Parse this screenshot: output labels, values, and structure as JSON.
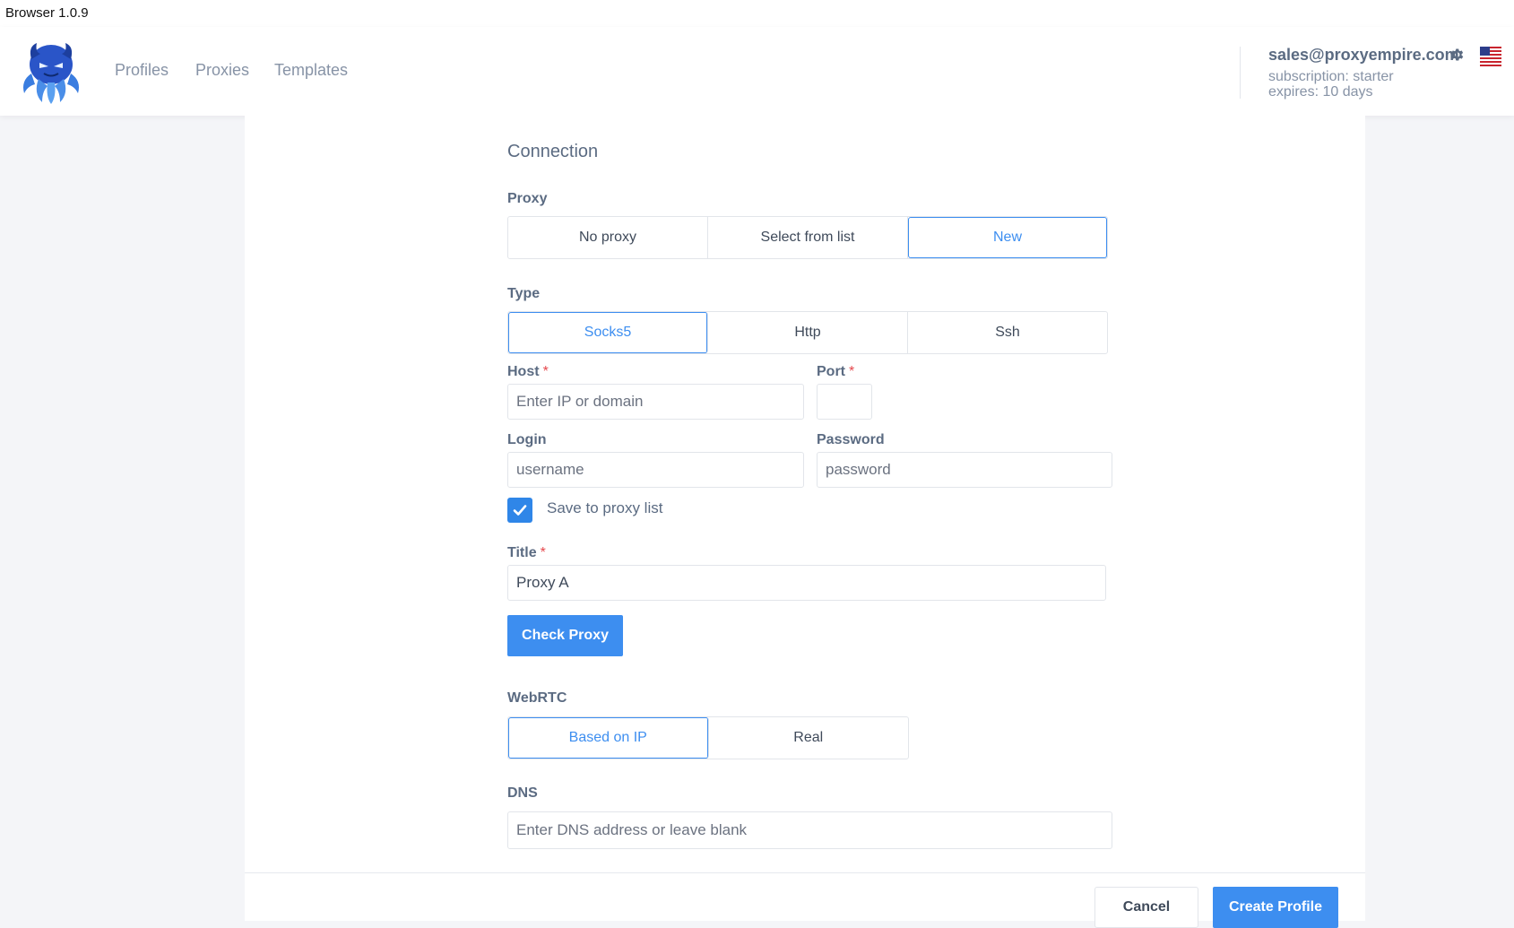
{
  "window": {
    "title": "Browser 1.0.9"
  },
  "nav": {
    "items": [
      "Profiles",
      "Proxies",
      "Templates"
    ]
  },
  "account": {
    "email": "sales@proxyempire.com",
    "subscription": "subscription: starter",
    "expires": "expires: 10 days"
  },
  "connection": {
    "section_title": "Connection",
    "proxy": {
      "label": "Proxy",
      "options": [
        "No proxy",
        "Select from list",
        "New"
      ],
      "selected": "New"
    },
    "type": {
      "label": "Type",
      "options": [
        "Socks5",
        "Http",
        "Ssh"
      ],
      "selected": "Socks5"
    },
    "host": {
      "label": "Host",
      "required_mark": "*",
      "placeholder": "Enter IP or domain",
      "value": ""
    },
    "port": {
      "label": "Port",
      "required_mark": "*",
      "value": ""
    },
    "login": {
      "label": "Login",
      "placeholder": "username",
      "value": ""
    },
    "password": {
      "label": "Password",
      "placeholder": "password",
      "value": ""
    },
    "save_to_list": {
      "label": "Save to proxy list",
      "checked": true
    },
    "title": {
      "label": "Title",
      "required_mark": "*",
      "value": "Proxy A"
    },
    "check_button": "Check Proxy",
    "webrtc": {
      "label": "WebRTC",
      "options": [
        "Based on IP",
        "Real"
      ],
      "selected": "Based on IP"
    },
    "dns": {
      "label": "DNS",
      "placeholder": "Enter DNS address or leave blank",
      "value": ""
    }
  },
  "footer": {
    "cancel": "Cancel",
    "create": "Create Profile"
  },
  "colors": {
    "accent": "#3d8ef0",
    "required": "#e5484d",
    "text": "#3f4a5a",
    "muted": "#8793a6"
  },
  "icons": {
    "logo": "octopus-logo-icon",
    "settings": "gear-icon",
    "language": "us-flag-icon",
    "checkbox": "check-icon"
  }
}
